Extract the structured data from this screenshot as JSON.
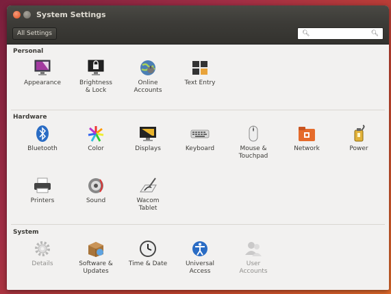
{
  "window": {
    "title": "System Settings"
  },
  "toolbar": {
    "all_settings": "All Settings",
    "search_placeholder": ""
  },
  "sections": {
    "personal": {
      "title": "Personal",
      "items": [
        {
          "label": "Appearance",
          "icon": "appearance-icon"
        },
        {
          "label": "Brightness\n& Lock",
          "icon": "lock-icon"
        },
        {
          "label": "Online\nAccounts",
          "icon": "online-accounts-icon"
        },
        {
          "label": "Text Entry",
          "icon": "text-entry-icon"
        }
      ]
    },
    "hardware": {
      "title": "Hardware",
      "items": [
        {
          "label": "Bluetooth",
          "icon": "bluetooth-icon"
        },
        {
          "label": "Color",
          "icon": "color-icon"
        },
        {
          "label": "Displays",
          "icon": "display-icon"
        },
        {
          "label": "Keyboard",
          "icon": "keyboard-icon"
        },
        {
          "label": "Mouse &\nTouchpad",
          "icon": "mouse-icon"
        },
        {
          "label": "Network",
          "icon": "network-icon"
        },
        {
          "label": "Power",
          "icon": "power-icon"
        },
        {
          "label": "Printers",
          "icon": "printer-icon"
        },
        {
          "label": "Sound",
          "icon": "sound-icon"
        },
        {
          "label": "Wacom\nTablet",
          "icon": "tablet-icon"
        }
      ]
    },
    "system": {
      "title": "System",
      "items": [
        {
          "label": "Details",
          "icon": "gear-icon"
        },
        {
          "label": "Software &\nUpdates",
          "icon": "software-icon"
        },
        {
          "label": "Time & Date",
          "icon": "clock-icon"
        },
        {
          "label": "Universal\nAccess",
          "icon": "accessibility-icon"
        },
        {
          "label": "User\nAccounts",
          "icon": "users-icon"
        }
      ]
    }
  }
}
